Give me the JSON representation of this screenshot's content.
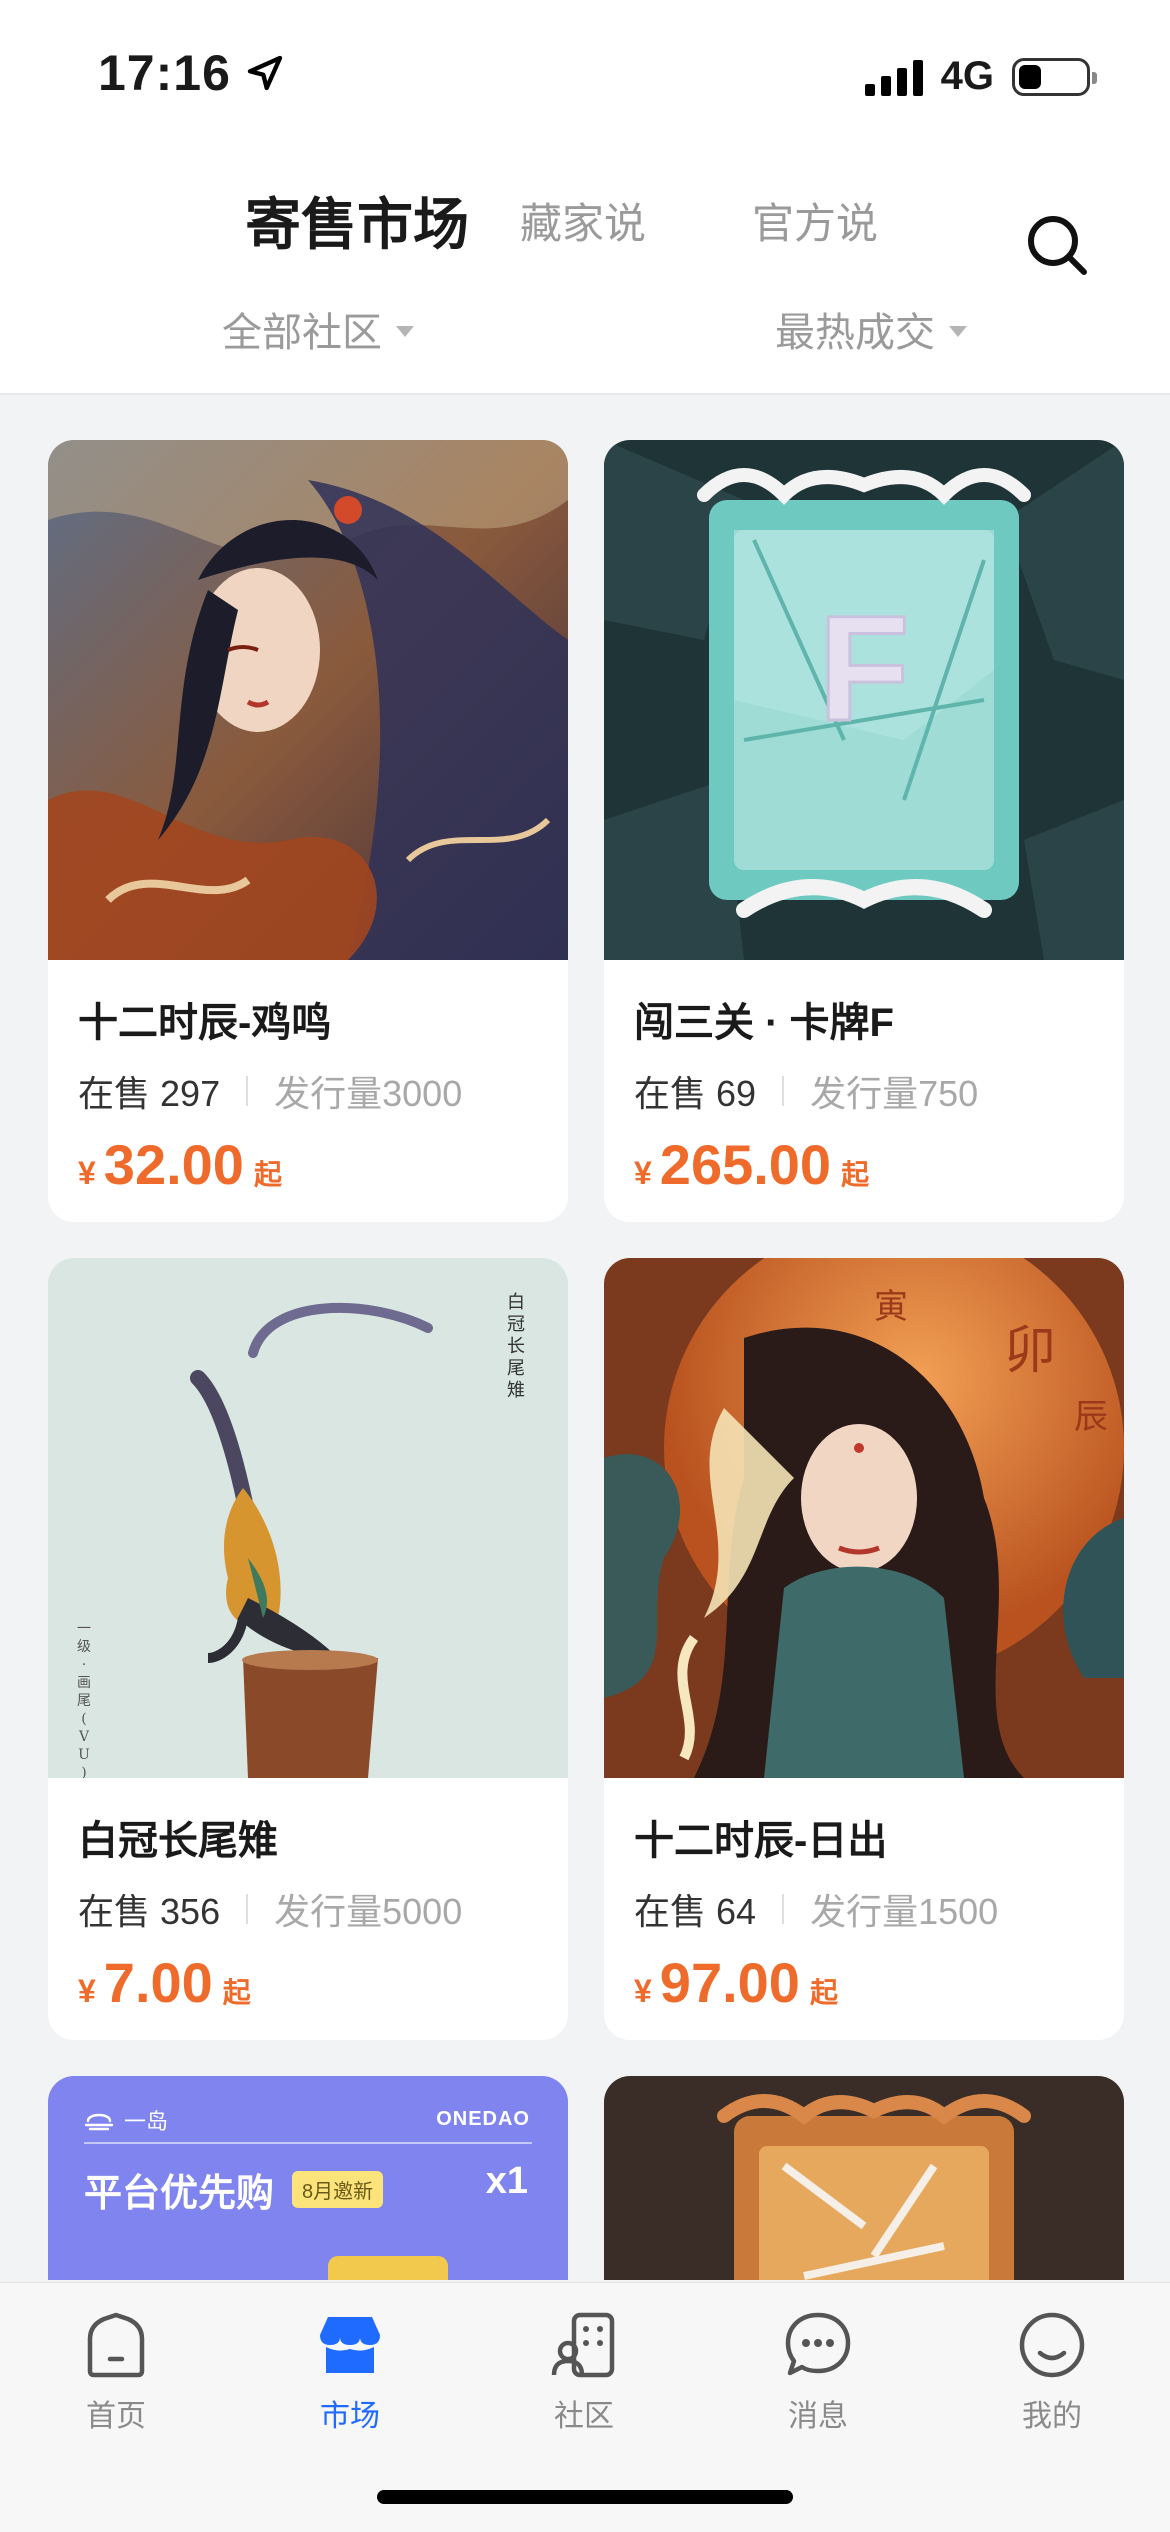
{
  "status": {
    "time": "17:16",
    "network": "4G",
    "battery_level": 0.35
  },
  "header": {
    "tabs": [
      {
        "label": "寄售市场",
        "active": true
      },
      {
        "label": "藏家说",
        "active": false
      },
      {
        "label": "官方说",
        "active": false
      }
    ],
    "filters": [
      {
        "label": "全部社区"
      },
      {
        "label": "最热成交"
      }
    ]
  },
  "labels": {
    "on_sale": "在售",
    "issue": "发行量",
    "currency": "¥",
    "from": "起"
  },
  "items": [
    {
      "name": "十二时辰-鸡鸣",
      "on_sale": "297",
      "issue": "3000",
      "price": "32.00",
      "art": "painting-woman-rooster"
    },
    {
      "name": "闯三关 · 卡牌F",
      "on_sale": "69",
      "issue": "750",
      "price": "265.00",
      "art": "card-letter-f"
    },
    {
      "name": "白冠长尾雉",
      "on_sale": "356",
      "issue": "5000",
      "price": "7.00",
      "art": "pheasant-illustration"
    },
    {
      "name": "十二时辰-日出",
      "on_sale": "64",
      "issue": "1500",
      "price": "97.00",
      "art": "painting-woman-sunrise"
    }
  ],
  "promo": {
    "brand": "一岛",
    "brand_en": "ONEDAO",
    "title": "平台优先购",
    "badge": "8月邀新",
    "count": "x1"
  },
  "art_texts": {
    "pheasant_name": "白冠长尾雉",
    "pheasant_sig": "一级·画尾(VU)",
    "sunrise_chars": [
      "寅",
      "卯",
      "辰"
    ]
  },
  "nav": [
    {
      "label": "首页",
      "icon": "home-icon",
      "active": false
    },
    {
      "label": "市场",
      "icon": "store-icon",
      "active": true
    },
    {
      "label": "社区",
      "icon": "community-icon",
      "active": false
    },
    {
      "label": "消息",
      "icon": "message-icon",
      "active": false
    },
    {
      "label": "我的",
      "icon": "profile-icon",
      "active": false
    }
  ],
  "colors": {
    "accent": "#1f6bff",
    "price": "#ef6b2c",
    "promo_bg": "#7f84ee"
  }
}
